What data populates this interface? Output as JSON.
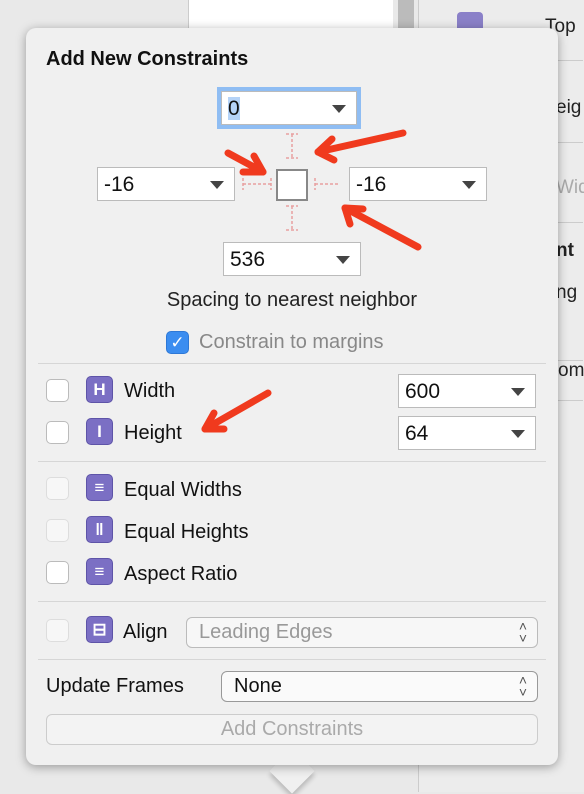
{
  "background": {
    "fragments": [
      "Top",
      "eig",
      "Wid",
      "nt",
      "ng",
      "om"
    ]
  },
  "popover": {
    "title": "Add New Constraints",
    "spacing": {
      "top": "0",
      "left": "-16",
      "right": "-16",
      "bottom": "536",
      "caption": "Spacing to nearest neighbor"
    },
    "constrain_to_margins": {
      "label": "Constrain to margins",
      "checked": true
    },
    "size": [
      {
        "label": "Width",
        "value": "600",
        "checked": false,
        "icon": "width-icon"
      },
      {
        "label": "Height",
        "value": "64",
        "checked": false,
        "icon": "height-icon"
      }
    ],
    "equal": [
      {
        "label": "Equal Widths",
        "checked": false,
        "icon": "equal-widths-icon"
      },
      {
        "label": "Equal Heights",
        "checked": false,
        "icon": "equal-heights-icon"
      },
      {
        "label": "Aspect Ratio",
        "checked": false,
        "icon": "aspect-ratio-icon"
      }
    ],
    "align": {
      "label": "Align",
      "value": "Leading Edges",
      "checked": false
    },
    "update_frames": {
      "label": "Update Frames",
      "value": "None"
    },
    "add_button": "Add Constraints"
  },
  "colors": {
    "accent": "#3b8df0",
    "icon": "#7b6fc4",
    "annotation": "#f03a1e"
  }
}
